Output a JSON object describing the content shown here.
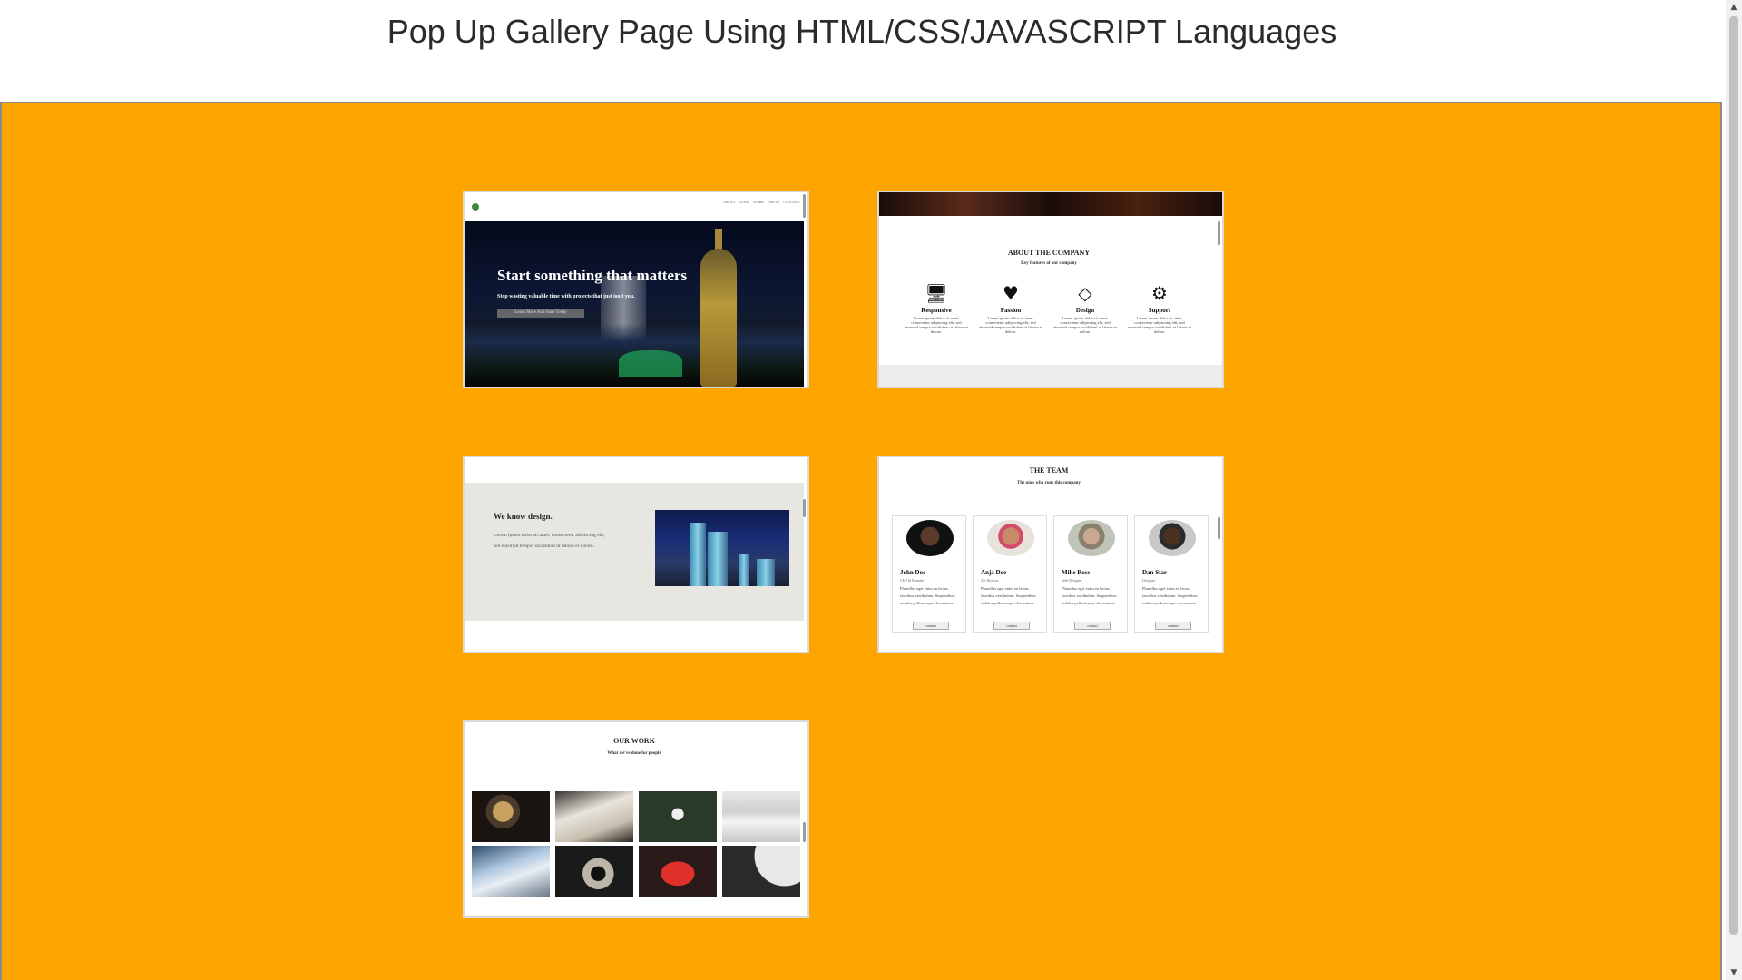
{
  "page": {
    "title": "Pop Up Gallery Page Using HTML/CSS/JAVASCRIPT Languages"
  },
  "colors": {
    "gallery_background": "#ffa500",
    "thumb_border": "#d9d9d9"
  },
  "gallery": {
    "thumbnails": [
      {
        "id": "home",
        "nav_links": "ABOUT TEAM WORK PHOTO CONTACT",
        "hero_title": "Start something that matters",
        "hero_subtitle": "Stop wasting valuable time with projects that just isn't you.",
        "hero_button": "Learn More And Start Today"
      },
      {
        "id": "about",
        "title": "ABOUT THE COMPANY",
        "subtitle": "Key features of our company",
        "features": [
          {
            "icon": "desktop-icon",
            "glyph": "🖥",
            "name": "Responsive",
            "desc": "Lorem ipsum dolor sit amet, consectetur adipiscing elit, sed eiusmod tempor incididunt ut labore et dolore."
          },
          {
            "icon": "heart-icon",
            "glyph": "♥",
            "name": "Passion",
            "desc": "Lorem ipsum dolor sit amet, consectetur adipiscing elit, sed eiusmod tempor incididunt ut labore et dolore."
          },
          {
            "icon": "diamond-icon",
            "glyph": "◇",
            "name": "Design",
            "desc": "Lorem ipsum dolor sit amet, consectetur adipiscing elit, sed eiusmod tempor incididunt ut labore et dolore."
          },
          {
            "icon": "gear-icon",
            "glyph": "⚙",
            "name": "Support",
            "desc": "Lorem ipsum dolor sit amet, consectetur adipiscing elit, sed eiusmod tempor incididunt ut labore et dolore."
          }
        ]
      },
      {
        "id": "design",
        "heading": "We know design.",
        "body": "Lorem ipsum dolor sit amet, consectetur adipiscing elit, sed eiusmod tempor incididunt ut labore et dolore."
      },
      {
        "id": "team",
        "title": "THE TEAM",
        "subtitle": "The ones who runs this company",
        "members": [
          {
            "name": "John Doe",
            "role": "CEO & Founder",
            "desc": "Phasellus eget enim eu lectus faucibus vestibulum. Suspendisse sodales pellentesque elementum.",
            "button": "contact"
          },
          {
            "name": "Anja Doe",
            "role": "Art Director",
            "desc": "Phasellus eget enim eu lectus faucibus vestibulum. Suspendisse sodales pellentesque elementum.",
            "button": "contact"
          },
          {
            "name": "Mike Ross",
            "role": "Web Designer",
            "desc": "Phasellus eget enim eu lectus faucibus vestibulum. Suspendisse sodales pellentesque elementum.",
            "button": "contact"
          },
          {
            "name": "Dan Star",
            "role": "Designer",
            "desc": "Phasellus eget enim eu lectus faucibus vestibulum. Suspendisse sodales pellentesque elementum.",
            "button": "contact"
          }
        ]
      },
      {
        "id": "work",
        "title": "OUR WORK",
        "subtitle": "What we've done for people"
      }
    ]
  },
  "scrollbar": {
    "up": "▲",
    "down": "▼"
  }
}
